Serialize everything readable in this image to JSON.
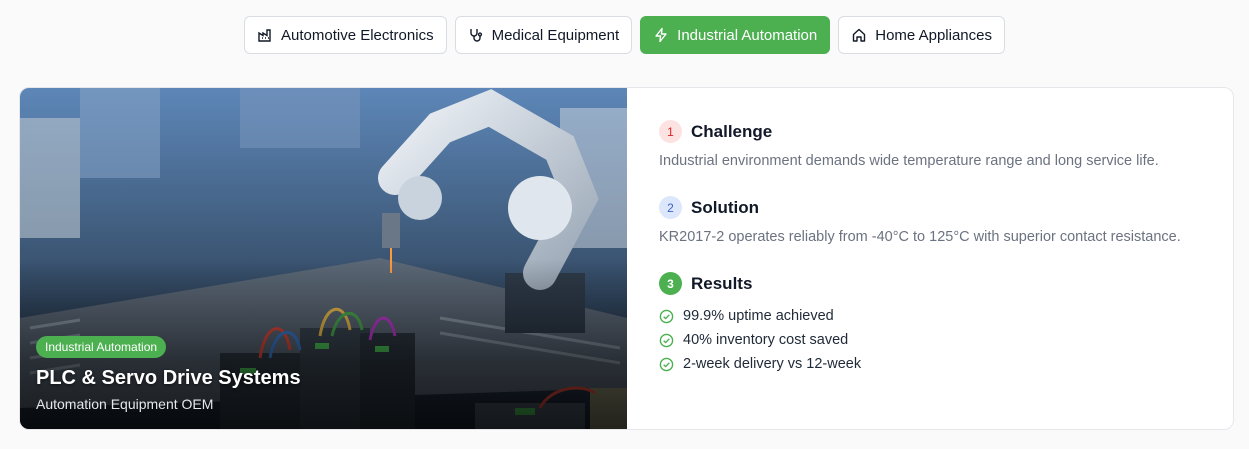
{
  "tabs": [
    {
      "label": "Automotive Electronics",
      "icon": "factory-icon",
      "active": false
    },
    {
      "label": "Medical Equipment",
      "icon": "stethoscope-icon",
      "active": false
    },
    {
      "label": "Industrial Automation",
      "icon": "lightning-icon",
      "active": true
    },
    {
      "label": "Home Appliances",
      "icon": "home-icon",
      "active": false
    }
  ],
  "case": {
    "badge": "Industrial Automation",
    "title": "PLC & Servo Drive Systems",
    "subtitle": "Automation Equipment OEM"
  },
  "steps": {
    "challenge": {
      "number": "1",
      "title": "Challenge",
      "text": "Industrial environment demands wide temperature range and long service life."
    },
    "solution": {
      "number": "2",
      "title": "Solution",
      "text": "KR2017-2 operates reliably from -40°C to 125°C with superior contact resistance."
    },
    "results": {
      "number": "3",
      "title": "Results",
      "items": [
        "99.9% uptime achieved",
        "40% inventory cost saved",
        "2-week delivery vs 12-week"
      ]
    }
  },
  "colors": {
    "accent": "#4caf50",
    "challenge": "#dc2626",
    "solution": "#3b63c7"
  }
}
